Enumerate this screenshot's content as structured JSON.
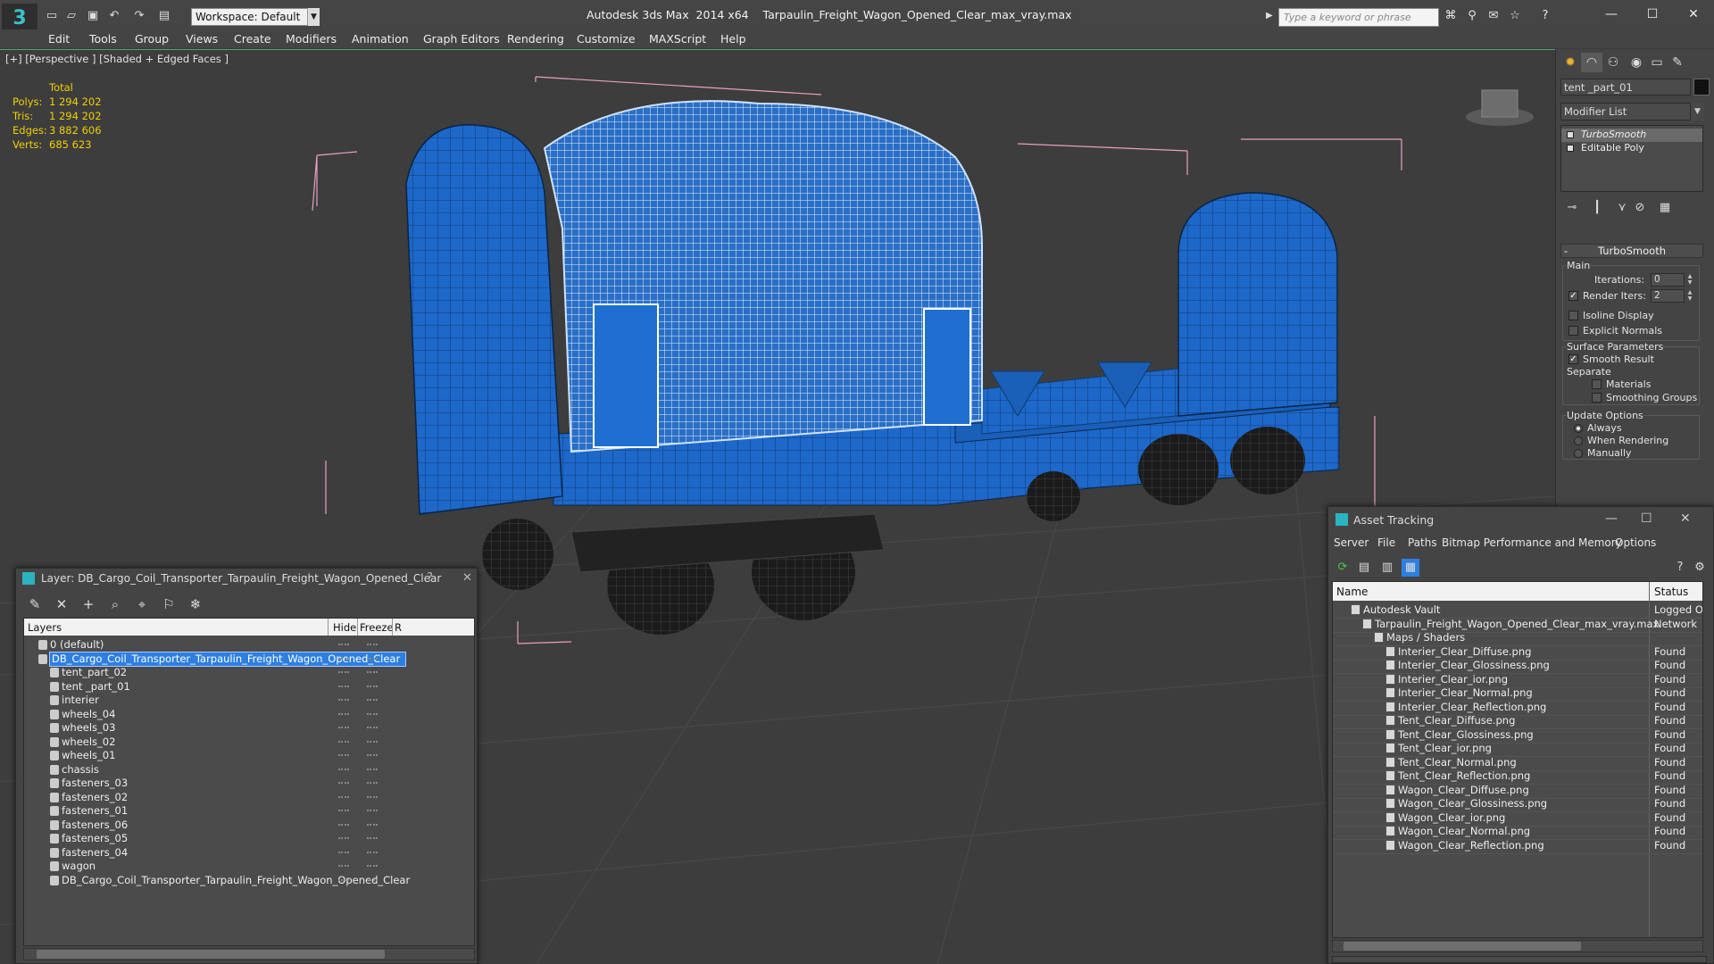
{
  "titlebar": {
    "workspace": "Workspace: Default",
    "app_name": "Autodesk 3ds Max  2014 x64",
    "file_name": "Tarpaulin_Freight_Wagon_Opened_Clear_max_vray.max",
    "search_placeholder": "Type a keyword or phrase",
    "logo_glyph": "3"
  },
  "menu": [
    "Edit",
    "Tools",
    "Group",
    "Views",
    "Create",
    "Modifiers",
    "Animation",
    "Graph Editors",
    "Rendering",
    "Customize",
    "MAXScript",
    "Help"
  ],
  "viewport": {
    "label": "[+] [Perspective ] [Shaded + Edged Faces ]",
    "stats": {
      "header": "Total",
      "rows": [
        {
          "label": "Polys:",
          "value": "1 294 202"
        },
        {
          "label": "Tris:",
          "value": "1 294 202"
        },
        {
          "label": "Edges:",
          "value": "3 882 606"
        },
        {
          "label": "Verts:",
          "value": "685 623"
        }
      ]
    }
  },
  "command_panel": {
    "object_name": "tent _part_01",
    "modifier_list": "Modifier List",
    "stack": [
      "TurboSmooth",
      "Editable Poly"
    ],
    "rollout_title": "TurboSmooth",
    "main_group": "Main",
    "iterations_label": "Iterations:",
    "iterations_value": "0",
    "render_iters_label": "Render Iters:",
    "render_iters_value": "2",
    "isoline": "Isoline Display",
    "explicit_normals": "Explicit Normals",
    "surface_group": "Surface Parameters",
    "smooth_result": "Smooth Result",
    "separate": "Separate",
    "materials": "Materials",
    "smoothing_groups": "Smoothing Groups",
    "update_group": "Update Options",
    "always": "Always",
    "when_rendering": "When Rendering",
    "manually": "Manually"
  },
  "layer_window": {
    "title": "Layer: DB_Cargo_Coil_Transporter_Tarpaulin_Freight_Wagon_Opened_Clear",
    "help": "?",
    "close": "✕",
    "col_layers": "Layers",
    "col_hide": "Hide",
    "col_freeze": "Freeze",
    "col_r": "R",
    "layers": [
      {
        "name": "0 (default)",
        "level": 0
      },
      {
        "name": "DB_Cargo_Coil_Transporter_Tarpaulin_Freight_Wagon_Opened_Clear",
        "level": 0,
        "selected": true
      },
      {
        "name": "tent_part_02",
        "level": 1
      },
      {
        "name": "tent _part_01",
        "level": 1
      },
      {
        "name": "interier",
        "level": 1
      },
      {
        "name": "wheels_04",
        "level": 1
      },
      {
        "name": "wheels_03",
        "level": 1
      },
      {
        "name": "wheels_02",
        "level": 1
      },
      {
        "name": "wheels_01",
        "level": 1
      },
      {
        "name": "chassis",
        "level": 1
      },
      {
        "name": "fasteners_03",
        "level": 1
      },
      {
        "name": "fasteners_02",
        "level": 1
      },
      {
        "name": "fasteners_01",
        "level": 1
      },
      {
        "name": "fasteners_06",
        "level": 1
      },
      {
        "name": "fasteners_05",
        "level": 1
      },
      {
        "name": "fasteners_04",
        "level": 1
      },
      {
        "name": "wagon",
        "level": 1
      },
      {
        "name": "DB_Cargo_Coil_Transporter_Tarpaulin_Freight_Wagon_Opened_Clear",
        "level": 1
      }
    ]
  },
  "asset_window": {
    "title": "Asset Tracking",
    "menus": [
      "Server",
      "File",
      "Paths",
      "Bitmap Performance and Memory",
      "Options"
    ],
    "col_name": "Name",
    "col_status": "Status",
    "rows": [
      {
        "name": "Autodesk Vault",
        "status": "Logged O",
        "level": 0
      },
      {
        "name": "Tarpaulin_Freight_Wagon_Opened_Clear_max_vray.max",
        "status": "Network",
        "level": 1
      },
      {
        "name": "Maps / Shaders",
        "status": "",
        "level": 2
      },
      {
        "name": "Interier_Clear_Diffuse.png",
        "status": "Found",
        "level": 3
      },
      {
        "name": "Interier_Clear_Glossiness.png",
        "status": "Found",
        "level": 3
      },
      {
        "name": "Interier_Clear_ior.png",
        "status": "Found",
        "level": 3
      },
      {
        "name": "Interier_Clear_Normal.png",
        "status": "Found",
        "level": 3
      },
      {
        "name": "Interier_Clear_Reflection.png",
        "status": "Found",
        "level": 3
      },
      {
        "name": "Tent_Clear_Diffuse.png",
        "status": "Found",
        "level": 3
      },
      {
        "name": "Tent_Clear_Glossiness.png",
        "status": "Found",
        "level": 3
      },
      {
        "name": "Tent_Clear_ior.png",
        "status": "Found",
        "level": 3
      },
      {
        "name": "Tent_Clear_Normal.png",
        "status": "Found",
        "level": 3
      },
      {
        "name": "Tent_Clear_Reflection.png",
        "status": "Found",
        "level": 3
      },
      {
        "name": "Wagon_Clear_Diffuse.png",
        "status": "Found",
        "level": 3
      },
      {
        "name": "Wagon_Clear_Glossiness.png",
        "status": "Found",
        "level": 3
      },
      {
        "name": "Wagon_Clear_ior.png",
        "status": "Found",
        "level": 3
      },
      {
        "name": "Wagon_Clear_Normal.png",
        "status": "Found",
        "level": 3
      },
      {
        "name": "Wagon_Clear_Reflection.png",
        "status": "Found",
        "level": 3
      }
    ]
  },
  "colors": {
    "wagon_blue": "#1f6fd0",
    "stats_yellow": "#f0d000",
    "selection_blue": "#2d7fe0",
    "bbox_pink": "#e8a0c0"
  }
}
